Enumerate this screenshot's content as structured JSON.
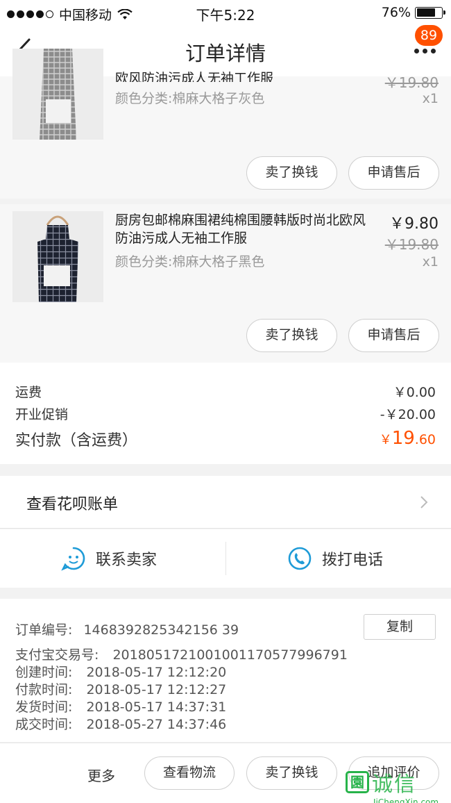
{
  "status_bar": {
    "carrier": "中国移动",
    "time": "下午5:22",
    "battery": "76%",
    "battery_fraction": 0.76
  },
  "nav": {
    "title": "订单详情",
    "badge": "89"
  },
  "products": [
    {
      "title": "欧风防油污成人无袖工作服",
      "sku": "颜色分类:棉麻大格子灰色",
      "orig_price": "￥19.80",
      "qty": "x1",
      "btn_sell": "卖了换钱",
      "btn_after": "申请售后"
    },
    {
      "title": "厨房包邮棉麻围裙纯棉围腰韩版时尚北欧风防油污成人无袖工作服",
      "sku": "颜色分类:棉麻大格子黑色",
      "price": "￥9.80",
      "orig_price": "￥19.80",
      "qty": "x1",
      "btn_sell": "卖了换钱",
      "btn_after": "申请售后"
    }
  ],
  "summary": {
    "shipping_label": "运费",
    "shipping_value": "￥0.00",
    "promo_label": "开业促销",
    "promo_value": "-￥20.00",
    "total_label": "实付款（含运费）",
    "total_currency": "￥",
    "total_int": "19",
    "total_dec": ".60"
  },
  "huabei": {
    "label": "查看花呗账单"
  },
  "contact": {
    "seller": "联系卖家",
    "call": "拨打电话"
  },
  "order_info": {
    "order_no_label": "订单编号:",
    "order_no": "1468392825342156 39",
    "copy": "复制",
    "alipay_label": "支付宝交易号:",
    "alipay_no": "2018051721001001170577996791",
    "created_label": "创建时间:",
    "created": "2018-05-17 12:12:20",
    "paid_label": "付款时间:",
    "paid": "2018-05-17 12:12:27",
    "shipped_label": "发货时间:",
    "shipped": "2018-05-17 14:37:31",
    "done_label": "成交时间:",
    "done": "2018-05-27 14:37:46"
  },
  "bottom": {
    "more": "更多",
    "logistics": "查看物流",
    "sell": "卖了换钱",
    "review": "追加评价"
  },
  "watermark": {
    "text": "诚信",
    "url": "JiChengXin.com"
  },
  "colors": {
    "accent": "#ff5000",
    "watermark": "#27b34a"
  }
}
